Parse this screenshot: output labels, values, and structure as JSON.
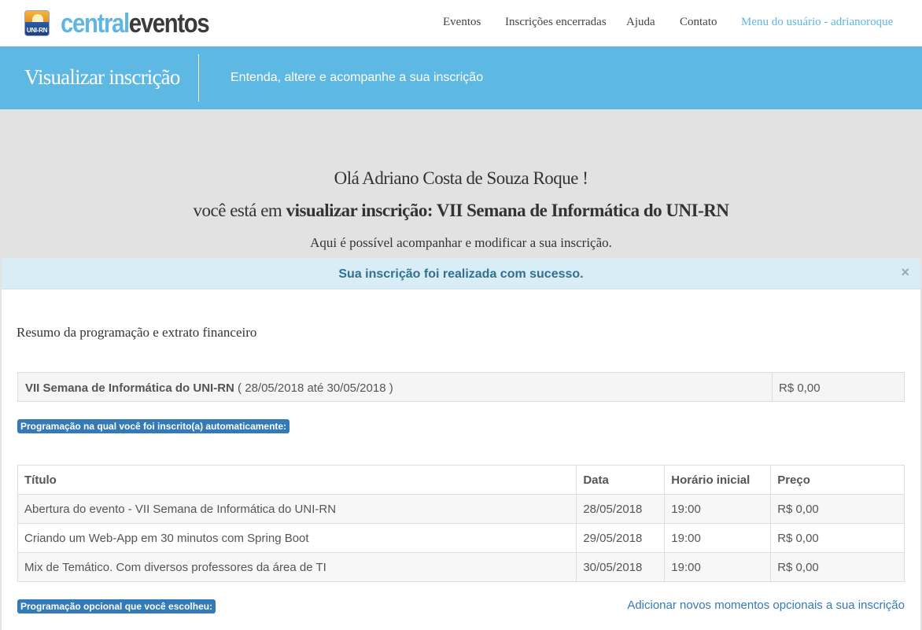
{
  "brand": {
    "badge_text": "UNI-RN",
    "wordmark_part1": "central",
    "wordmark_part2": "eventos"
  },
  "nav": {
    "items": [
      {
        "label": "Eventos"
      },
      {
        "label": "Inscrições encerradas"
      },
      {
        "label": "Ajuda"
      },
      {
        "label": "Contato"
      },
      {
        "label": "Menu do usuário - adrianoroque"
      }
    ]
  },
  "header": {
    "title": "Visualizar inscrição",
    "subtitle": "Entenda, altere e acompanhe a sua inscrição"
  },
  "greeting": {
    "line1": "Olá Adriano Costa de Souza Roque !",
    "line2_prefix": "você está em ",
    "line2_bold": "visualizar inscrição: VII Semana de Informática do UNI-RN",
    "line3": "Aqui é possível acompanhar e modificar a sua inscrição."
  },
  "alert": {
    "message": "Sua inscrição foi realizada com sucesso.",
    "close_symbol": "×"
  },
  "summary": {
    "title": "Resumo da programação e extrato financeiro",
    "event_name": "VII Semana de Informática do UNI-RN",
    "event_dates": " ( 28/05/2018 até 30/05/2018 )",
    "event_price": "R$ 0,00"
  },
  "auto_program": {
    "label": "Programação na qual você foi inscrito(a) automaticamente:",
    "columns": [
      "Título",
      "Data",
      "Horário inicial",
      "Preço"
    ],
    "rows": [
      [
        "Abertura do evento - VII Semana de Informática do UNI-RN",
        "28/05/2018",
        "19:00",
        "R$ 0,00"
      ],
      [
        "Criando um Web-App em 30 minutos com Spring Boot",
        "29/05/2018",
        "19:00",
        "R$ 0,00"
      ],
      [
        "Mix de Temático. Com diversos professores da área de TI",
        "30/05/2018",
        "19:00",
        "R$ 0,00"
      ]
    ]
  },
  "optional_program": {
    "label": "Programação opcional que você escolheu:",
    "add_link": "Adicionar novos momentos opcionais a sua inscrição"
  },
  "colors": {
    "accent": "#5eb8e4",
    "alert_bg": "#d9edf7",
    "alert_text": "#31708f",
    "badge": "#337ab7",
    "link": "#337ab7"
  },
  "icons": {
    "logo": "uni-rn-logo-icon",
    "close": "close-icon"
  }
}
